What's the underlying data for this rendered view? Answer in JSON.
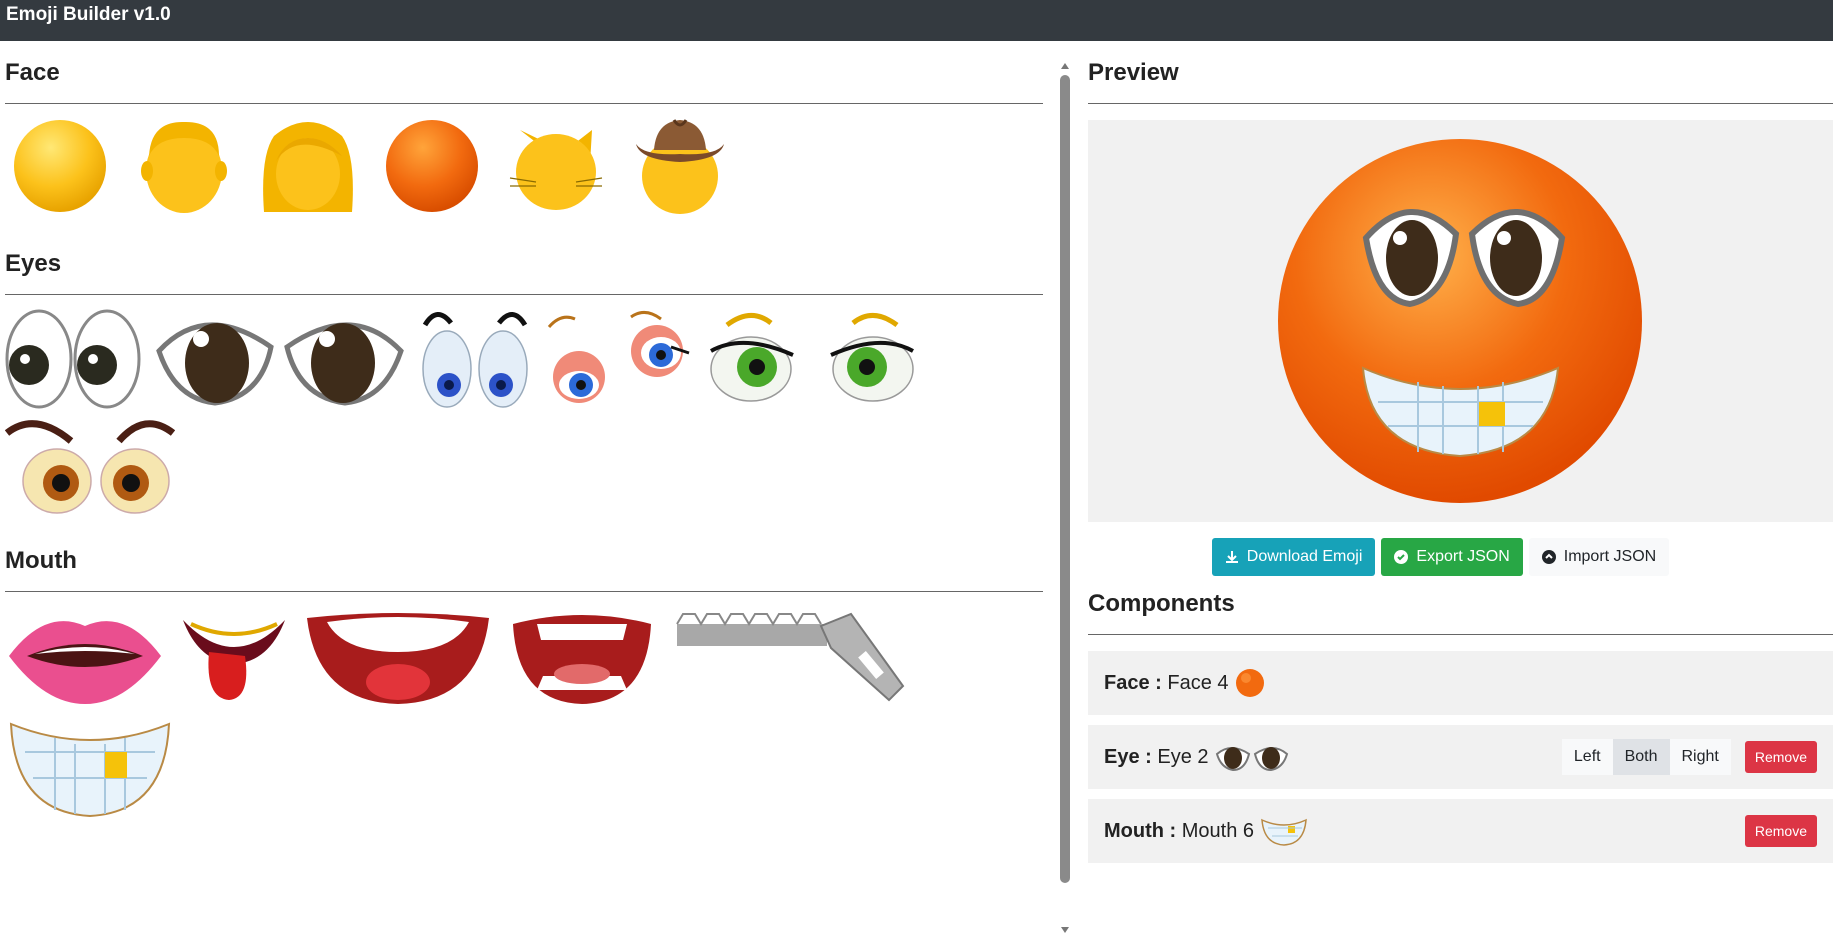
{
  "app": {
    "title": "Emoji Builder v1.0"
  },
  "sections": {
    "face_title": "Face",
    "eyes_title": "Eyes",
    "mouth_title": "Mouth",
    "preview_title": "Preview",
    "components_title": "Components"
  },
  "face_items": [
    "face-1",
    "face-2",
    "face-3",
    "face-4",
    "face-5",
    "face-6"
  ],
  "eye_items": [
    "eye-1",
    "eye-2",
    "eye-3",
    "eye-4",
    "eye-5",
    "eye-6"
  ],
  "mouth_items": [
    "mouth-1",
    "mouth-2",
    "mouth-3",
    "mouth-4",
    "mouth-5",
    "mouth-6"
  ],
  "buttons": {
    "download": "Download Emoji",
    "export": "Export JSON",
    "import": "Import JSON"
  },
  "components": {
    "face": {
      "key": "Face :",
      "value": "Face 4"
    },
    "eye": {
      "key": "Eye :",
      "value": "Eye 2",
      "left": "Left",
      "both": "Both",
      "right": "Right",
      "remove": "Remove",
      "active": "Both"
    },
    "mouth": {
      "key": "Mouth :",
      "value": "Mouth 6",
      "remove": "Remove"
    }
  },
  "colors": {
    "topbar": "#343a40",
    "info": "#17a2b8",
    "success": "#28a745",
    "danger": "#dc3545",
    "face_yellow": "#fcc21b",
    "face_orange": "#f26a0f"
  }
}
